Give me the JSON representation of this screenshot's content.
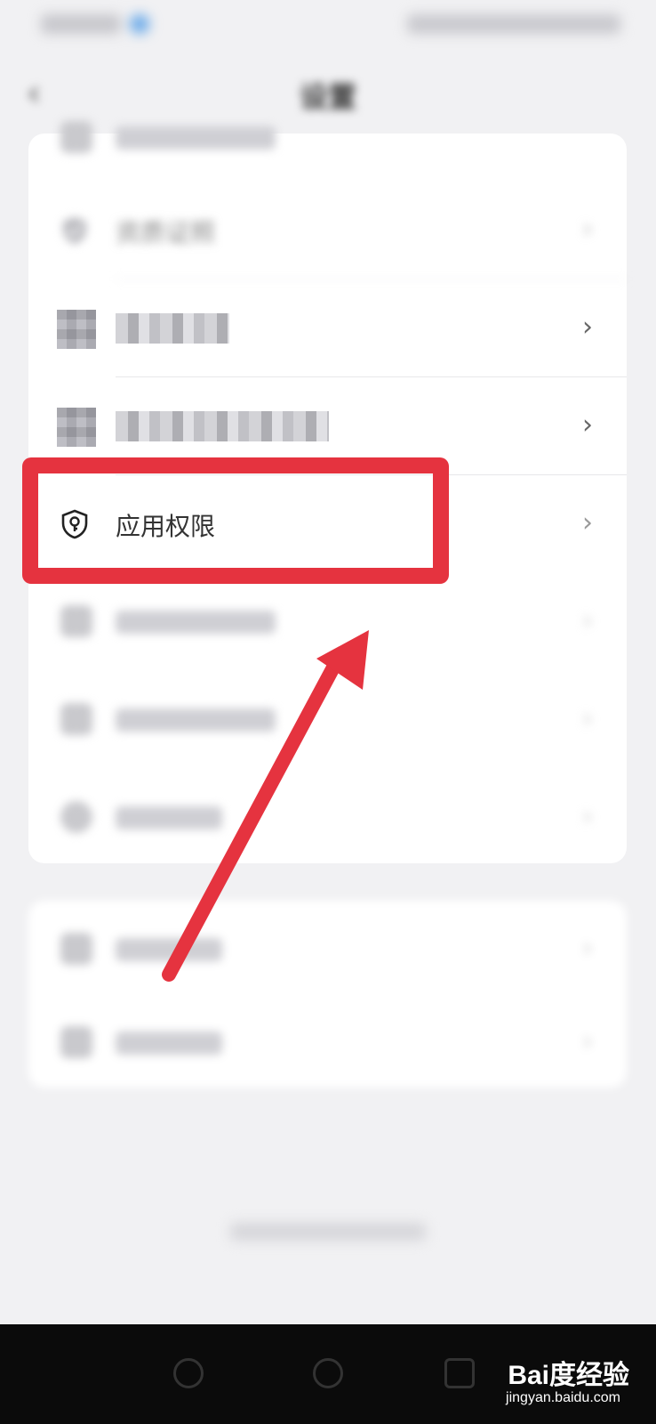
{
  "header": {
    "title": "设置"
  },
  "rows": {
    "qualification": {
      "label": "资质证照",
      "icon": "shield-check-icon"
    },
    "app_permissions": {
      "label": "应用权限",
      "icon": "shield-key-icon"
    }
  },
  "colors": {
    "highlight": "#e5333f",
    "background": "#f1f1f3",
    "card": "#ffffff"
  },
  "watermark": {
    "main": "Bai度经验",
    "sub": "jingyan.baidu.com"
  }
}
